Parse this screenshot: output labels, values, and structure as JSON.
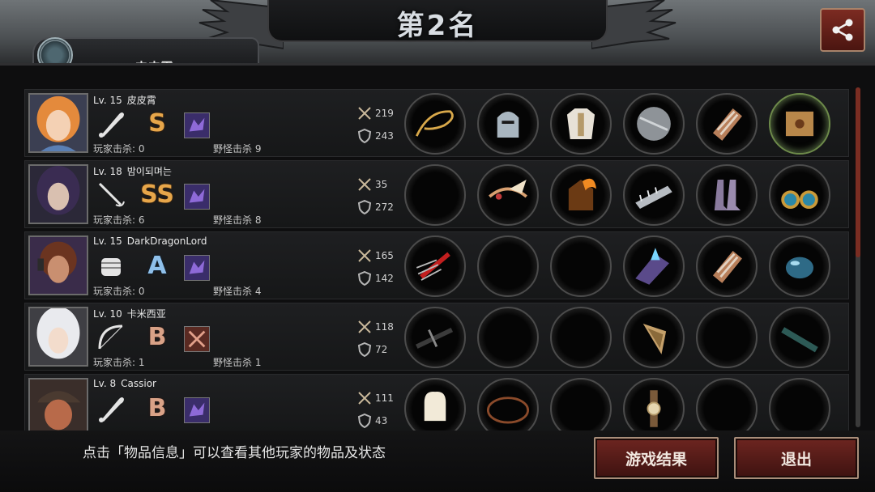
{
  "header": {
    "title": "第2名",
    "player_tab_name": "皮皮霄",
    "share_icon": "share-icon"
  },
  "players": [
    {
      "level": "Lv. 15",
      "name": "皮皮霄",
      "weapon_icon": "bat-icon",
      "grade": "S",
      "player_kills": "玩家击杀: 0",
      "monster_kills": "野怪击杀 9",
      "attack": "219",
      "defense": "243",
      "items": [
        "whip-icon",
        "knight-helmet-icon",
        "white-armor-icon",
        "round-shield-icon",
        "bracer-icon",
        "crate-icon"
      ]
    },
    {
      "level": "Lv. 18",
      "name": "밤이되며는",
      "weapon_icon": "rapier-icon",
      "grade": "SS",
      "player_kills": "玩家击杀: 6",
      "monster_kills": "野怪击杀 8",
      "attack": "35",
      "defense": "272",
      "items": [
        "empty",
        "winged-tiara-icon",
        "flame-armor-icon",
        "spiked-bracer-icon",
        "boots-icon",
        "earrings-icon"
      ]
    },
    {
      "level": "Lv. 15",
      "name": "DarkDragonLord",
      "weapon_icon": "fist-icon",
      "grade": "A",
      "player_kills": "玩家击杀: 0",
      "monster_kills": "野怪击杀 4",
      "attack": "165",
      "defense": "142",
      "items": [
        "claw-icon",
        "empty",
        "empty",
        "crystal-bracer-icon",
        "bracer-icon",
        "orb-icon"
      ]
    },
    {
      "level": "Lv. 10",
      "name": "卡米西亚",
      "weapon_icon": "bow-icon",
      "grade": "B",
      "player_kills": "玩家击杀: 1",
      "monster_kills": "野怪击杀 1",
      "attack": "118",
      "defense": "72",
      "items": [
        "crossbow-icon",
        "empty",
        "empty",
        "arrowhead-shield-icon",
        "empty",
        "baton-icon"
      ]
    },
    {
      "level": "Lv. 8",
      "name": "Cassior",
      "weapon_icon": "bat-icon",
      "grade": "B",
      "player_kills": "",
      "monster_kills": "",
      "attack": "111",
      "defense": "43",
      "items": [
        "chef-hat-icon",
        "ring-icon",
        "empty",
        "wristwatch-icon",
        "empty",
        "empty"
      ]
    }
  ],
  "footer": {
    "hint": "点击「物品信息」可以查看其他玩家的物品及状态",
    "result_button": "游戏结果",
    "exit_button": "退出"
  },
  "colors": {
    "button_fill": "#6d2520",
    "button_border": "#a98e7a",
    "grade_S": "#e7a64a",
    "grade_A": "#8fc0ea",
    "grade_B": "#d9a287"
  }
}
